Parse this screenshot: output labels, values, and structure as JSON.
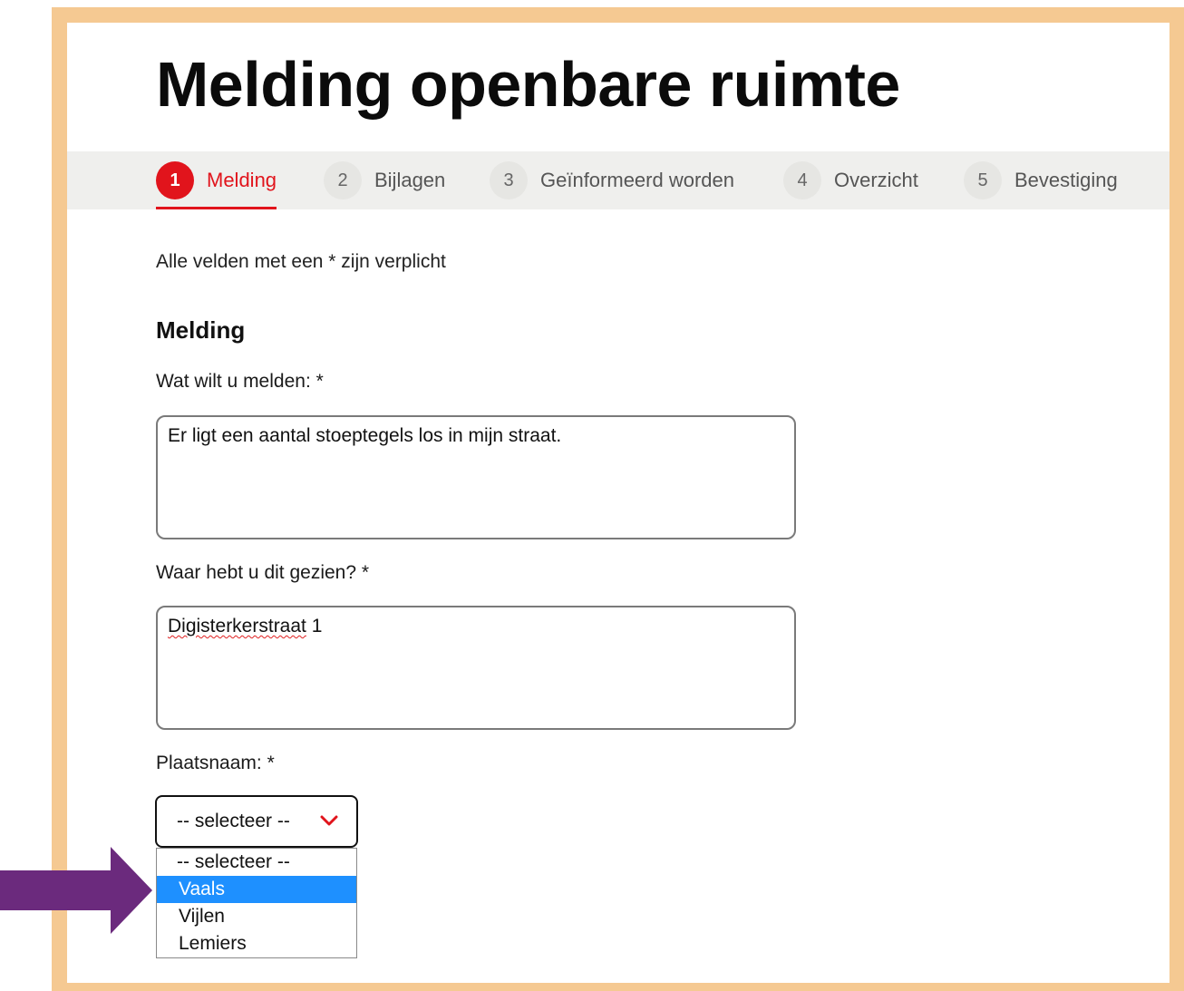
{
  "page": {
    "title": "Melding openbare ruimte",
    "frame_color": "#f5c992",
    "accent_color": "#e1141c"
  },
  "steps": [
    {
      "number": "1",
      "label": "Melding",
      "active": true
    },
    {
      "number": "2",
      "label": "Bijlagen",
      "active": false
    },
    {
      "number": "3",
      "label": "Geïnformeerd worden",
      "active": false
    },
    {
      "number": "4",
      "label": "Overzicht",
      "active": false
    },
    {
      "number": "5",
      "label": "Bevestiging",
      "active": false
    }
  ],
  "form": {
    "required_note": "Alle velden met een * zijn verplicht",
    "section_title": "Melding",
    "what_label": "Wat wilt u melden: *",
    "what_value": "Er ligt een aantal stoeptegels los in mijn straat.",
    "where_label": "Waar hebt u dit gezien? *",
    "where_value_word": "Digisterkerstraat",
    "where_value_rest": " 1",
    "place_label": "Plaatsnaam: *",
    "place_selected": "-- selecteer --",
    "place_options": [
      "-- selecteer --",
      "Vaals",
      "Vijlen",
      "Lemiers"
    ],
    "place_highlighted": "Vaals"
  },
  "annotation": {
    "arrow_color": "#6b2a7d",
    "arrow_icon": "arrow-right-icon"
  }
}
